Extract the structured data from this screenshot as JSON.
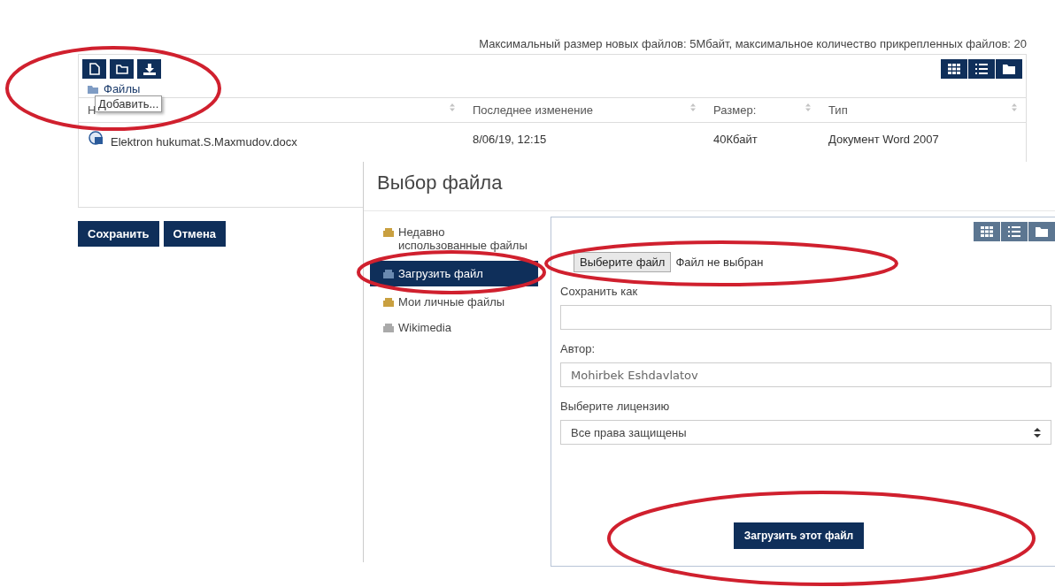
{
  "limits_note": "Максимальный размер новых файлов: 5Мбайт, максимальное количество прикрепленных файлов: 20",
  "file_manager": {
    "breadcrumb": "Файлы",
    "tooltip": "Добавить...",
    "columns": [
      "Н",
      "Последнее изменение",
      "Размер:",
      "Тип"
    ],
    "rows": [
      {
        "name": "Elektron hukumat.S.Maxmudov.docx",
        "modified": "8/06/19, 12:15",
        "size": "40Кбайт",
        "type": "Документ Word 2007"
      }
    ]
  },
  "buttons": [
    "Сохранить",
    "Отмена"
  ],
  "dialog": {
    "title": "Выбор файла",
    "repositories": [
      {
        "label": "Недавно использованные файлы",
        "selected": false
      },
      {
        "label": "Загрузить файл",
        "selected": true
      },
      {
        "label": "Мои личные файлы",
        "selected": false
      },
      {
        "label": "Wikimedia",
        "selected": false
      }
    ],
    "file_button": "Выберите файл",
    "file_status": "Файл не выбран",
    "save_as": {
      "label": "Сохранить как"
    },
    "author": {
      "label": "Автор:",
      "value": "Mohirbek Eshdavlatov"
    },
    "license": {
      "label": "Выберите лицензию",
      "value": "Все права защищены"
    },
    "upload_button": "Загрузить этот файл"
  }
}
